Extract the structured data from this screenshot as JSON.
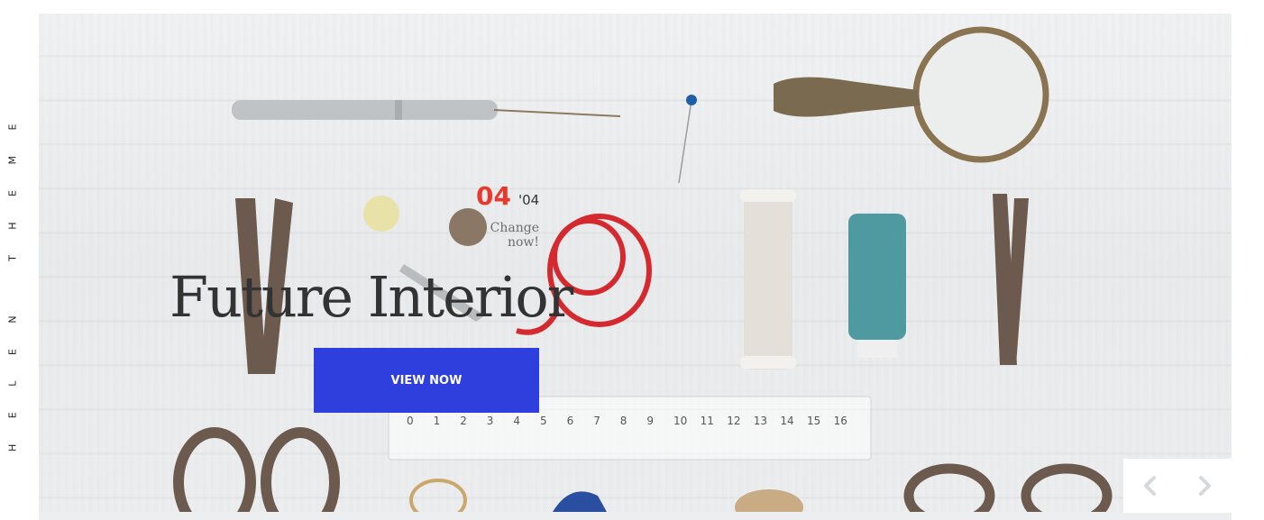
{
  "brand": {
    "vertical_text": "HELEN THEME"
  },
  "slide": {
    "current": "04",
    "total": "'04",
    "subtitle": "Change now!",
    "title": "Future Interior",
    "button_label": "VIEW NOW"
  },
  "ruler": {
    "numbers": [
      "0",
      "1",
      "2",
      "3",
      "4",
      "5",
      "6",
      "7",
      "8",
      "9",
      "10",
      "11",
      "12",
      "13",
      "14",
      "15",
      "16"
    ]
  },
  "nav": {
    "prev_icon": "chevron-left-icon",
    "next_icon": "chevron-right-icon"
  },
  "colors": {
    "accent": "#e8392c",
    "button": "#2e3fdd",
    "title": "#333333"
  }
}
